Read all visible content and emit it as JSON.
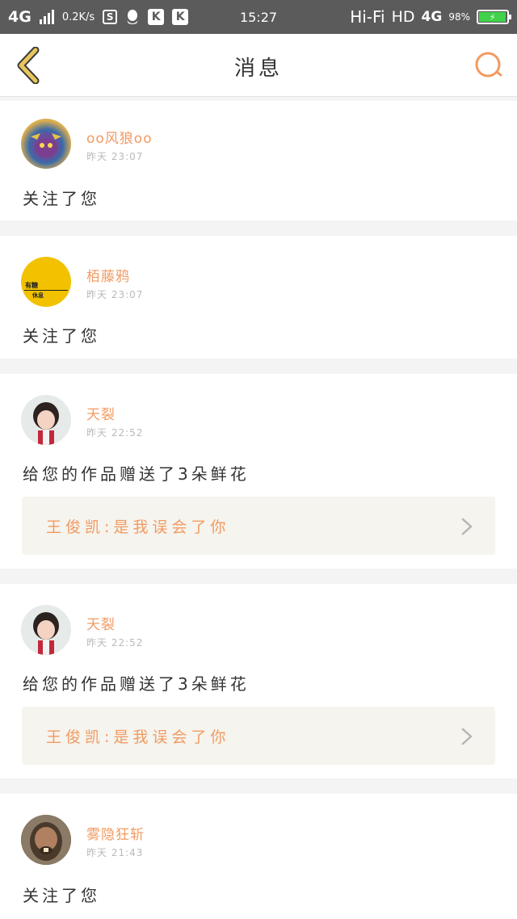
{
  "status_bar": {
    "network": "4G",
    "speed": "0.2K/s",
    "app_icon_1": "S",
    "app_icon_3": "K",
    "app_icon_4": "K",
    "time": "15:27",
    "hifi": "Hi-Fi",
    "hd": "HD",
    "net2": "4G",
    "battery_pct": "98%",
    "battery_level": 0.98
  },
  "header": {
    "title": "消息"
  },
  "messages": [
    {
      "user": "oo风狼oo",
      "time": "昨天 23:07",
      "action": "关注了您"
    },
    {
      "user": "栢藤鸦",
      "time": "昨天 23:07",
      "action": "关注了您",
      "avatar_text_1": "有糖",
      "avatar_text_2": "休息"
    },
    {
      "user": "天裂",
      "time": "昨天 22:52",
      "action": "给您的作品赠送了3朵鲜花",
      "quote": "王俊凯:是我误会了你"
    },
    {
      "user": "天裂",
      "time": "昨天 22:52",
      "action": "给您的作品赠送了3朵鲜花",
      "quote": "王俊凯:是我误会了你"
    },
    {
      "user": "雾隐狂斩",
      "time": "昨天 21:43",
      "action": "关注了您"
    }
  ],
  "colors": {
    "accent": "#f29a62",
    "back_arrow": "#e8c65b",
    "status_bg": "#5b5b5b"
  }
}
